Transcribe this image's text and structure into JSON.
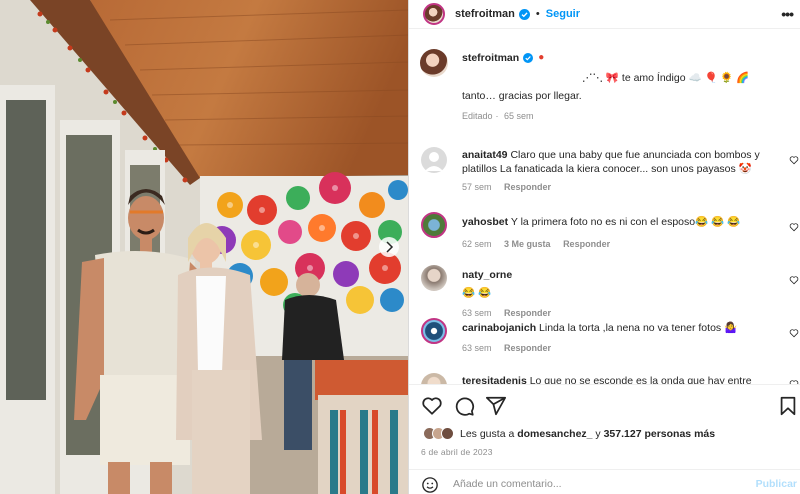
{
  "post": {
    "username": "stefroitman",
    "follow_label": "Seguir",
    "more_label": "•••",
    "caption_user": "stefroitman",
    "caption_line1": "⋰⋱ 🎀 te amo Índigo ☁️ 🎈 🌻 🌈",
    "caption_line2": "tanto… gracias por llegar.",
    "caption_meta_edited": "Editado",
    "caption_meta_time": "65 sem"
  },
  "comments": [
    {
      "user": "anaitat49",
      "text": "Claro que una baby que fue anunciada con bombos y platillos La fanaticada la kiera conocer... son unos payasos 🤡",
      "time": "57 sem",
      "likes": "",
      "reply": "Responder",
      "avatar_color": "#d8d8d8"
    },
    {
      "user": "yahosbet",
      "text": "Y la primera foto no es ni con el esposo😂 😂 😂",
      "time": "62 sem",
      "likes": "3 Me gusta",
      "reply": "Responder",
      "avatar_color": "#6a8a4a"
    },
    {
      "user": "naty_orne",
      "text": "😂 😂",
      "time": "63 sem",
      "likes": "",
      "reply": "Responder",
      "avatar_color": "#b9b0a8"
    },
    {
      "user": "carinabojanich",
      "text": "Linda la torta ,la nena no va tener fotos 🤷‍♀️",
      "time": "63 sem",
      "likes": "",
      "reply": "Responder",
      "avatar_color": "#1f4f7a"
    },
    {
      "user": "teresitadenis",
      "text": "Lo que no se esconde es la onda que hay entre",
      "time": "",
      "likes": "",
      "reply": "",
      "avatar_color": "#cbb9a6"
    }
  ],
  "actions": {
    "likes_prefix": "Les gusta a",
    "likes_user": "domesanchez_",
    "likes_mid": "y",
    "likes_count": "357.127 personas más",
    "date": "6 de abril de 2023"
  },
  "add_comment": {
    "placeholder": "Añade un comentario...",
    "publish_label": "Publicar"
  },
  "icons": [
    "verified-icon",
    "heart-icon",
    "comment-icon",
    "share-icon",
    "bookmark-icon",
    "emoji-icon",
    "more-icon",
    "next-photo-icon"
  ],
  "colors": {
    "link": "#0095f6",
    "muted": "#8e8e8e",
    "text": "#262626"
  }
}
